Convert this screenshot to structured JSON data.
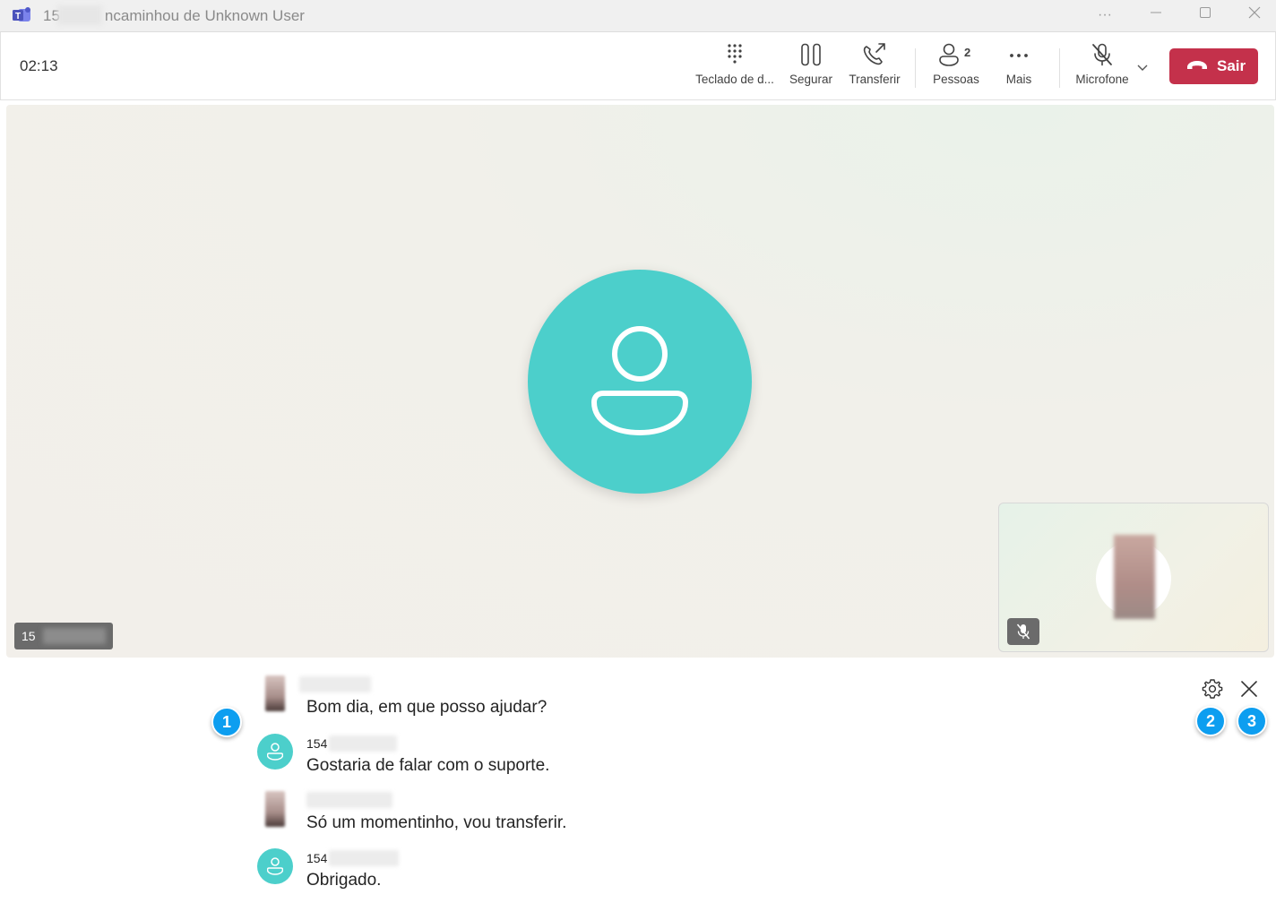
{
  "window": {
    "title_prefix": "15",
    "title_suffix": "ncaminhou de Unknown User"
  },
  "toolbar": {
    "timer": "02:13",
    "dialpad_label": "Teclado de d...",
    "hold_label": "Segurar",
    "transfer_label": "Transferir",
    "people_label": "Pessoas",
    "people_count": "2",
    "more_label": "Mais",
    "mic_label": "Microfone",
    "leave_label": "Sair",
    "leave_color": "#c4314b"
  },
  "stage": {
    "caller_name_prefix": "15",
    "avatar_color": "#4ccfcb"
  },
  "captions": {
    "messages": [
      {
        "speaker": "",
        "text": "Bom dia, em que posso ajudar?",
        "avatar": "photo"
      },
      {
        "speaker": "154",
        "text": "Gostaria de falar com o suporte.",
        "avatar": "person-icon"
      },
      {
        "speaker": "",
        "text": "Só um momentinho, vou transferir.",
        "avatar": "photo"
      },
      {
        "speaker": "154",
        "text": "Obrigado.",
        "avatar": "person-icon"
      }
    ],
    "badges": [
      "1",
      "2",
      "3"
    ],
    "badge_color": "#0d9ef0"
  }
}
